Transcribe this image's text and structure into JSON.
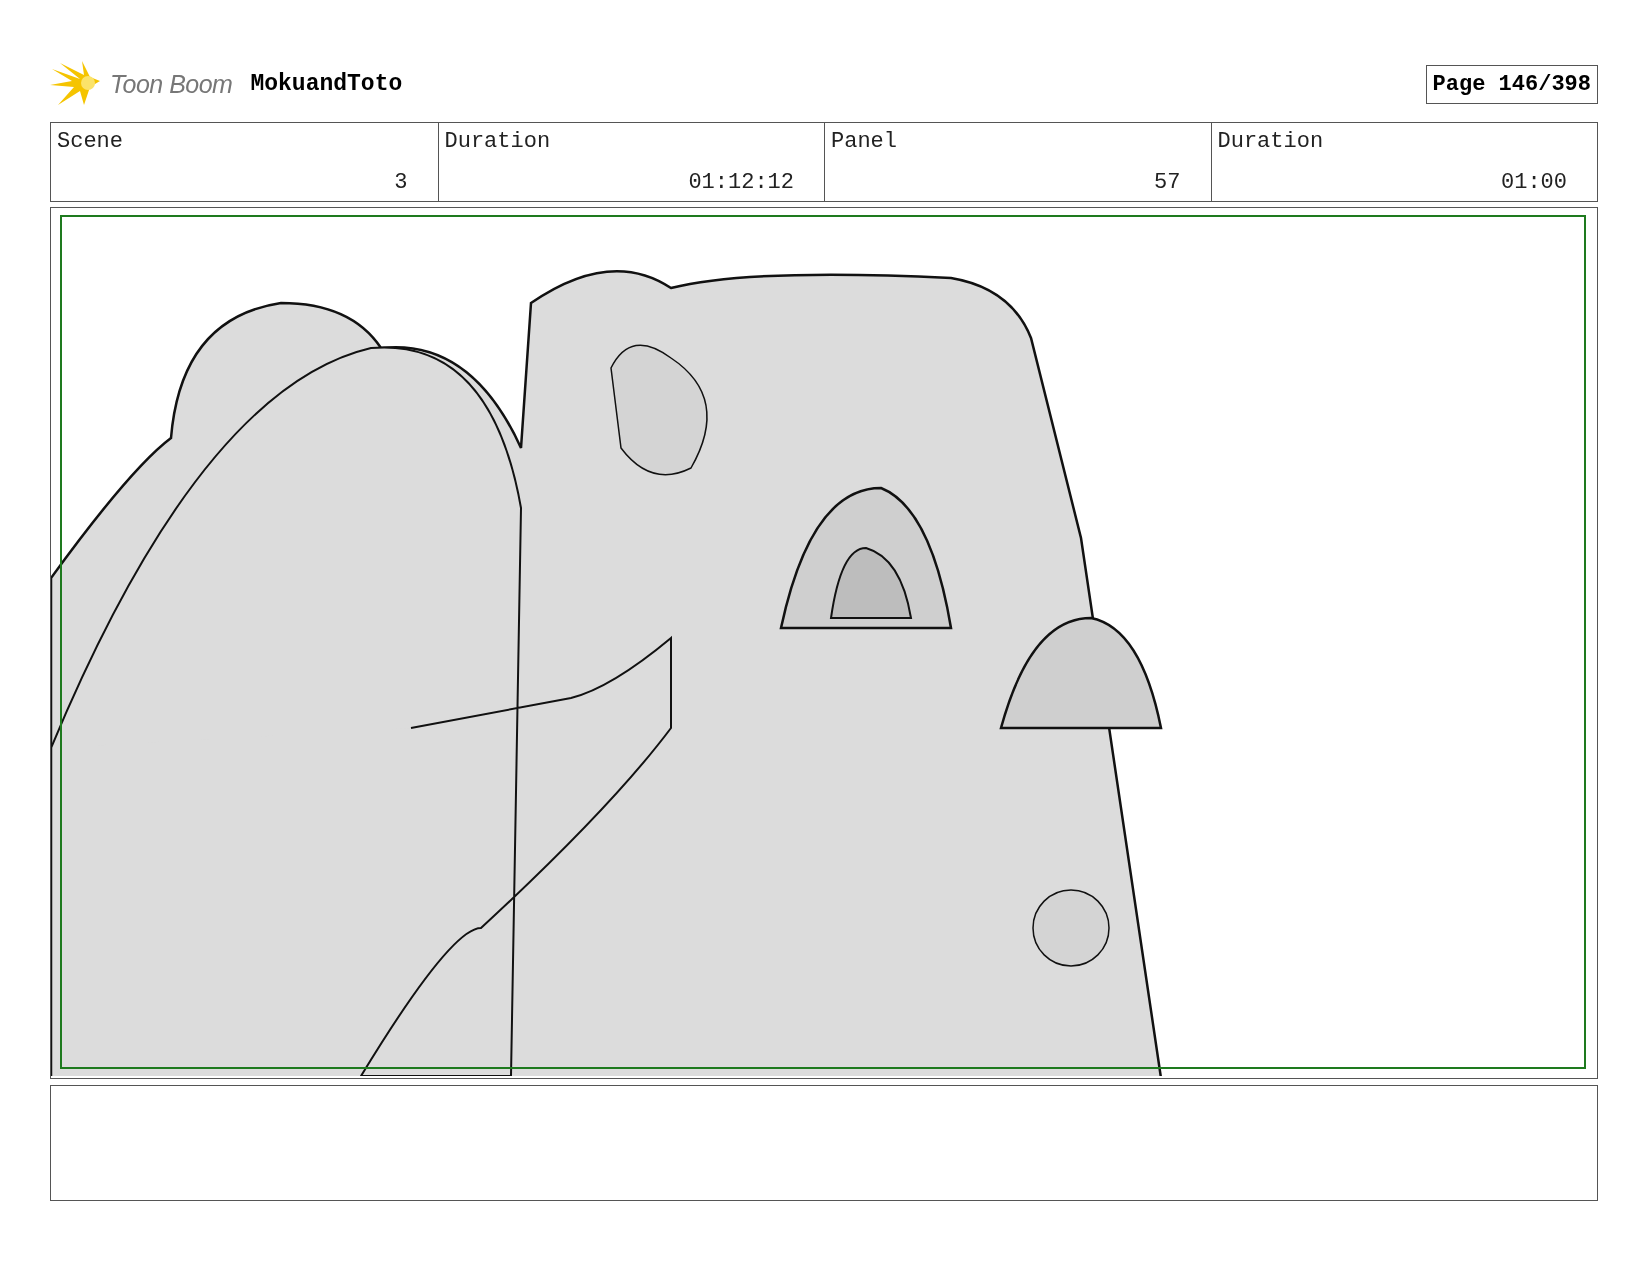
{
  "header": {
    "logo_text": "Toon Boom",
    "project": "MokuandToto",
    "page": "Page 146/398"
  },
  "info": [
    {
      "label": "Scene",
      "value": "3"
    },
    {
      "label": "Duration",
      "value": "01:12:12"
    },
    {
      "label": "Panel",
      "value": "57"
    },
    {
      "label": "Duration",
      "value": "01:00"
    }
  ]
}
